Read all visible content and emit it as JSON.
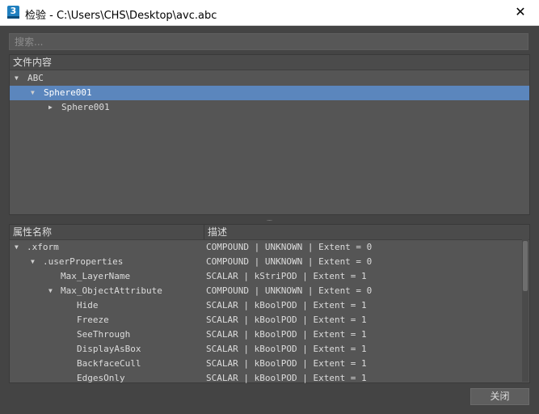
{
  "window": {
    "title": "检验 - C:\\Users\\CHS\\Desktop\\avc.abc",
    "app_icon_text": "3",
    "close_glyph": "✕"
  },
  "search": {
    "placeholder": "搜索..."
  },
  "file_panel": {
    "header": "文件内容",
    "tree": [
      {
        "label": "ABC",
        "arrow": "▼",
        "level": 0,
        "selected": false
      },
      {
        "label": "Sphere001",
        "arrow": "▼",
        "level": 1,
        "selected": true
      },
      {
        "label": "Sphere001",
        "arrow": "▶",
        "level": 2,
        "selected": false
      }
    ]
  },
  "splitter": {
    "glyph": "....."
  },
  "props_panel": {
    "columns": [
      "属性名称",
      "描述"
    ],
    "rows": [
      {
        "name": ".xform",
        "arrow": "▼",
        "level": 0,
        "desc": "COMPOUND | UNKNOWN | Extent = 0"
      },
      {
        "name": ".userProperties",
        "arrow": "▼",
        "level": 1,
        "desc": "COMPOUND | UNKNOWN | Extent = 0"
      },
      {
        "name": "Max_LayerName",
        "arrow": "",
        "level": 2,
        "desc": "SCALAR | kStriPOD | Extent = 1"
      },
      {
        "name": "Max_ObjectAttribute",
        "arrow": "▼",
        "level": 2,
        "desc": "COMPOUND | UNKNOWN | Extent = 0"
      },
      {
        "name": "Hide",
        "arrow": "",
        "level": 3,
        "desc": "SCALAR | kBoolPOD | Extent = 1"
      },
      {
        "name": "Freeze",
        "arrow": "",
        "level": 3,
        "desc": "SCALAR | kBoolPOD | Extent = 1"
      },
      {
        "name": "SeeThrough",
        "arrow": "",
        "level": 3,
        "desc": "SCALAR | kBoolPOD | Extent = 1"
      },
      {
        "name": "DisplayAsBox",
        "arrow": "",
        "level": 3,
        "desc": "SCALAR | kBoolPOD | Extent = 1"
      },
      {
        "name": "BackfaceCull",
        "arrow": "",
        "level": 3,
        "desc": "SCALAR | kBoolPOD | Extent = 1"
      },
      {
        "name": "EdgesOnly",
        "arrow": "",
        "level": 3,
        "desc": "SCALAR | kBoolPOD | Extent = 1"
      }
    ]
  },
  "buttons": {
    "close_label": "关闭"
  },
  "colors": {
    "background": "#444444",
    "selection": "#5b86bd",
    "panel": "#555555",
    "app_icon": "#1f7fbf"
  }
}
